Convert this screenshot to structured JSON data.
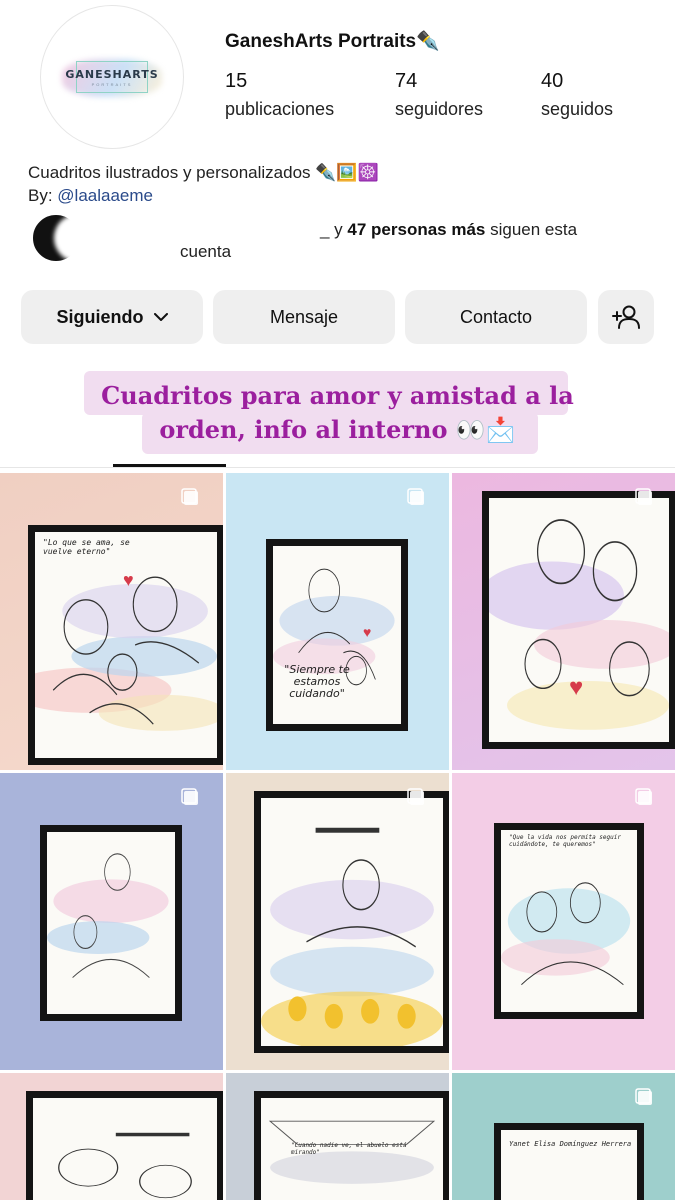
{
  "profile": {
    "username": "GaneshArts Portraits✒️",
    "logo_text": "GANESHARTS",
    "logo_sub": "PORTRAITS",
    "stats": [
      {
        "value": "15",
        "label": "publicaciones"
      },
      {
        "value": "74",
        "label": "seguidores"
      },
      {
        "value": "40",
        "label": "seguidos"
      }
    ],
    "bio_line": "Cuadritos ilustrados y personalizados ✒️🖼️☸️",
    "bio_by": "By: ",
    "bio_handle": "@laalaaeme",
    "mutual_prefix": "_ y ",
    "mutual_bold": "47 personas más",
    "mutual_suffix": " siguen esta cuenta"
  },
  "buttons": {
    "following": "Siguiendo",
    "message": "Mensaje",
    "contact": "Contacto"
  },
  "highlight": {
    "line1": "Cuadritos para amor y amistad a la",
    "line2": "orden, info al interno 👀📩"
  },
  "posts": [
    {
      "quote": "\"Lo que se ama, se vuelve eterno\""
    },
    {
      "quote": "\"Siempre te estamos cuidando\""
    },
    {
      "quote": ""
    },
    {
      "quote": ""
    },
    {
      "quote": ""
    },
    {
      "quote": "\"Que la vida nos permita seguir cuidándote, te queremos\""
    },
    {
      "quote": ""
    },
    {
      "quote": "\"Cuando nadie ve, el abuelo está mirando\""
    },
    {
      "quote": "Yanet Elisa Domínguez Herrera"
    }
  ],
  "colors": {
    "highlight_text": "#9b1f9e",
    "highlight_bg": "#f1ddf0",
    "button_bg": "#efefef",
    "link": "#2a4a8a"
  }
}
